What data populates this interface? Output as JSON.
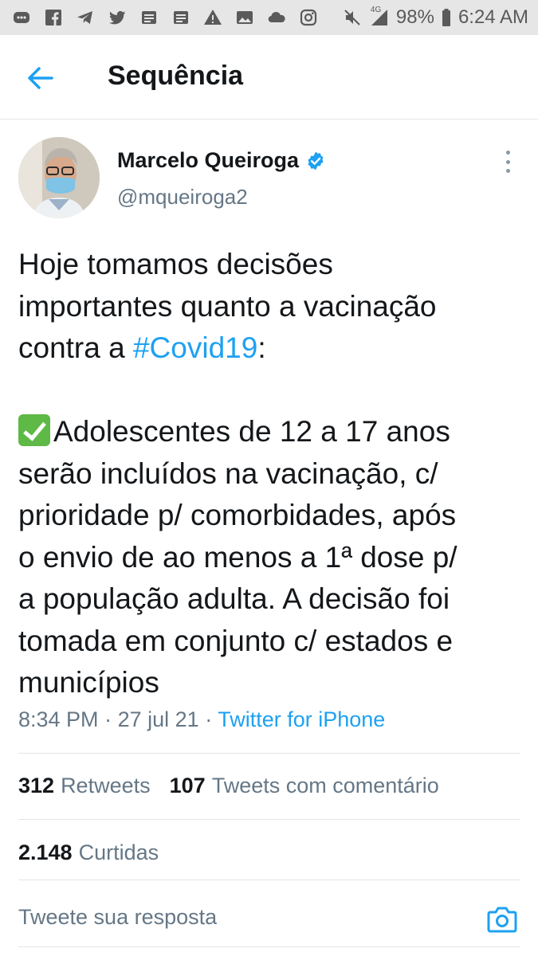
{
  "status_bar": {
    "battery": "98%",
    "network": "4G",
    "time": "6:24 AM",
    "icons": [
      "message-icon",
      "facebook-icon",
      "telegram-icon",
      "twitter-icon",
      "news-icon",
      "news-icon",
      "warning-icon",
      "image-icon",
      "cloud-icon",
      "instagram-icon",
      "mute-icon",
      "signal-icon",
      "battery-icon"
    ]
  },
  "header": {
    "title": "Sequência",
    "back_icon": "back-arrow-icon"
  },
  "tweet": {
    "author_name": "Marcelo Queiroga",
    "author_handle": "@mqueiroga2",
    "verified_icon": "verified-badge-icon",
    "text_lines": {
      "l1": "Hoje tomamos decisões",
      "l2": "importantes quanto a vacinação",
      "l3_pre": "contra a ",
      "l3_hashtag": "#Covid19",
      "l3_post": ":",
      "l4": "Adolescentes de 12 a 17 anos",
      "l5": "serão incluídos na vacinação, c/",
      "l6": "prioridade p/ comorbidades, após",
      "l7": "o envio de ao menos a 1ª dose p/",
      "l8": "a população adulta. A decisão foi",
      "l9": "tomada em conjunto c/ estados e",
      "l10": "municípios"
    },
    "time": "8:34 PM",
    "date": "27 jul 21",
    "separator": "·",
    "source": "Twitter for iPhone"
  },
  "stats": {
    "retweets_count": "312",
    "retweets_label": "Retweets",
    "quotes_count": "107",
    "quotes_label": "Tweets com comentário",
    "likes_count": "2.148",
    "likes_label": "Curtidas"
  },
  "reply": {
    "placeholder": "Tweete sua resposta",
    "camera_icon": "camera-icon"
  },
  "colors": {
    "accent": "#1da1f2",
    "text": "#14171a",
    "secondary": "#657786",
    "divider": "#e1e6ea",
    "status_bar_bg": "#e6e6e6"
  }
}
